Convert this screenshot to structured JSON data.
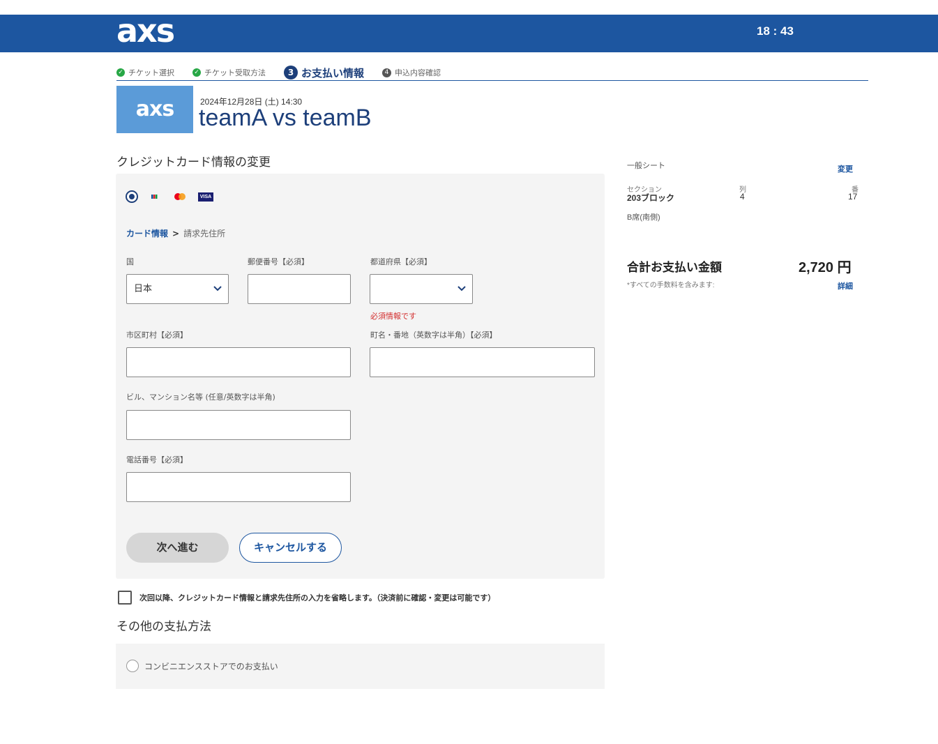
{
  "header": {
    "logo": "axs",
    "timer": "18 : 43",
    "bg_color": "#1d56a0"
  },
  "steps": [
    {
      "label": "チケット選択",
      "state": "done",
      "icon": "check-icon"
    },
    {
      "label": "チケット受取方法",
      "state": "done",
      "icon": "check-icon"
    },
    {
      "number": "3",
      "label": "お支払い情報",
      "state": "current"
    },
    {
      "number": "4",
      "label": "申込内容確認",
      "state": "upcoming"
    }
  ],
  "event": {
    "logo": "axs",
    "date": "2024年12月28日 (土) 14:30",
    "title": "teamA vs teamB"
  },
  "card_section": {
    "title": "クレジットカード情報の変更",
    "brand_icons": [
      "jcb-icon",
      "mastercard-icon",
      "visa-icon"
    ],
    "visa_text": "VISA",
    "breadcrumb": {
      "active": "カード情報",
      "sep": ">",
      "rest": "請求先住所"
    },
    "fields": {
      "country": {
        "label": "国",
        "value": "日本"
      },
      "postal": {
        "label": "郵便番号【必須】",
        "value": ""
      },
      "prefecture": {
        "label": "都道府県【必須】",
        "value": "",
        "error": "必須情報です"
      },
      "city": {
        "label": "市区町村【必須】",
        "value": ""
      },
      "street": {
        "label": "町名・番地（英数字は半角）【必須】",
        "value": ""
      },
      "building": {
        "label": "ビル、マンション名等 (任意/英数字は半角)",
        "value": ""
      },
      "phone": {
        "label": "電話番号【必須】",
        "value": ""
      }
    },
    "next_button": "次へ進む",
    "cancel_button": "キャンセルする"
  },
  "save_option": {
    "label": "次回以降、クレジットカード情報と請求先住所の入力を省略します。（決済前に確認・変更は可能です）",
    "checked": false
  },
  "other_section": {
    "title": "その他の支払方法",
    "convenience_label": "コンビニエンスストアでのお支払い"
  },
  "summary": {
    "seat_type": "一般シート",
    "change_link": "変更",
    "section_label": "セクション",
    "section_value": "203ブロック",
    "row_label": "列",
    "row_value": "4",
    "seat_label": "番",
    "seat_value": "17",
    "area": "B席(南側)",
    "total_label": "合計お支払い金額",
    "total_value": "2,720 円",
    "fee_note": "*すべての手数料を含みます:",
    "detail_link": "詳細"
  },
  "colors": {
    "brand": "#1d56a0",
    "accent_dark": "#1d3f7a",
    "error": "#d32f2f",
    "check": "#27a745"
  }
}
